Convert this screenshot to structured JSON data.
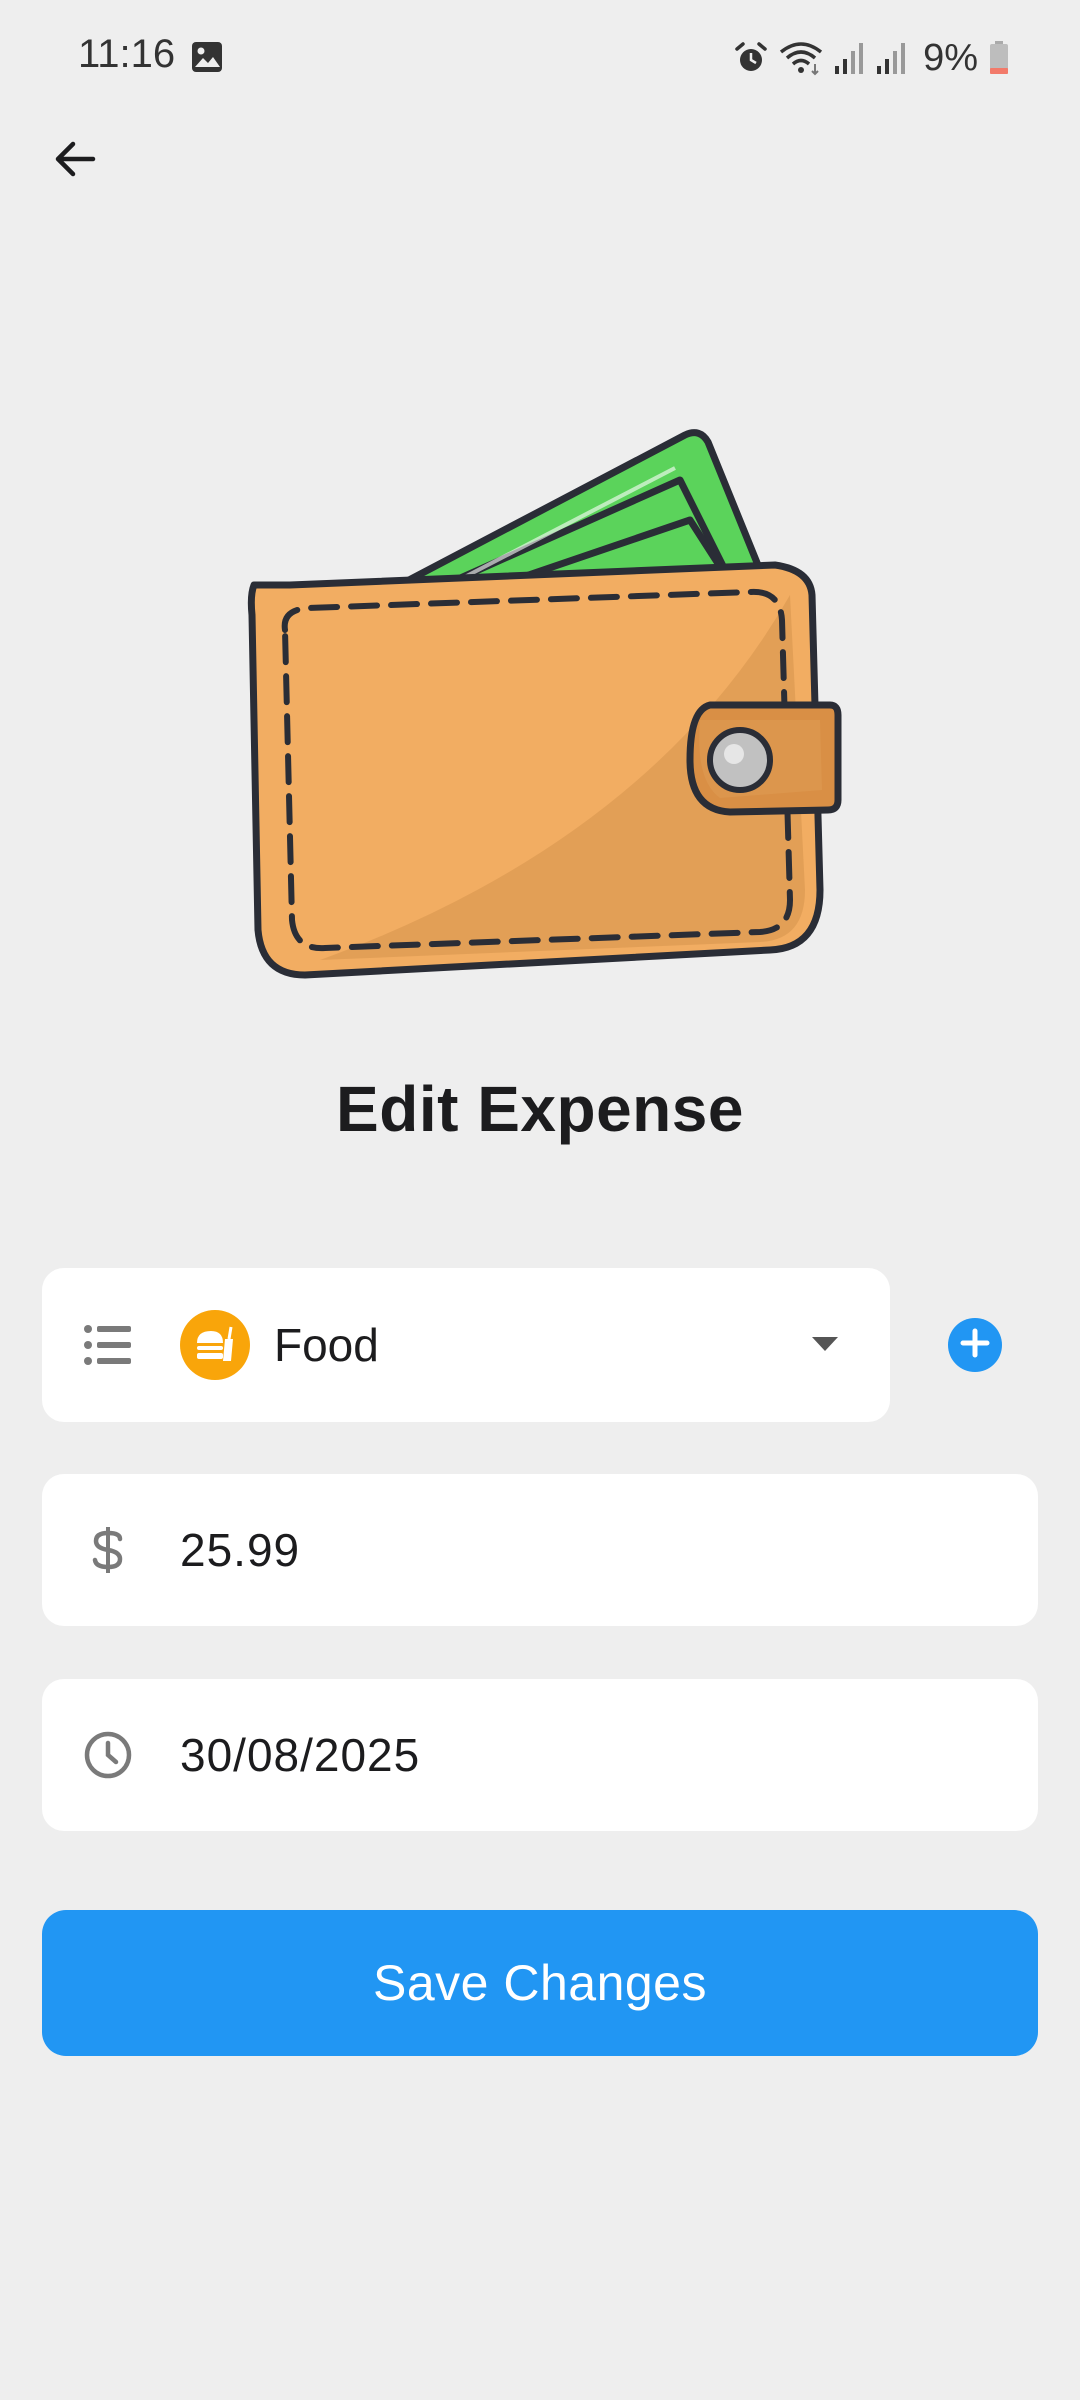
{
  "status_bar": {
    "time": "11:16",
    "battery": "9%",
    "icons": [
      "image-icon",
      "alarm-icon",
      "wifi-icon",
      "signal-icon",
      "signal-icon",
      "battery-icon"
    ]
  },
  "header": {
    "back_icon": "arrow-left-icon"
  },
  "illustration": {
    "icon": "wallet-illustration"
  },
  "title": "Edit Expense",
  "form": {
    "category": {
      "icon": "list-icon",
      "badge_icon": "food-icon",
      "value": "Food",
      "badge_color": "#f9a50a"
    },
    "add_category_icon": "plus-icon",
    "amount": {
      "icon": "dollar-icon",
      "value": "25.99"
    },
    "date": {
      "icon": "clock-icon",
      "value": "30/08/2025"
    }
  },
  "save_label": "Save Changes",
  "colors": {
    "accent": "#2196f3",
    "background": "#eeeeee",
    "wallet": "#f2ad62",
    "cash": "#5bd35b"
  }
}
